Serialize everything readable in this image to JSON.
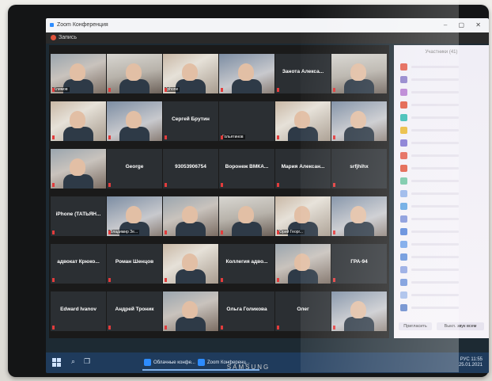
{
  "monitor": {
    "brand": "SAMSUNG",
    "corner_mark": ""
  },
  "window": {
    "title": "Zoom Конференция",
    "meeting_label": "Запись"
  },
  "gallery": {
    "tiles": [
      {
        "name": "",
        "label": "Климов",
        "video": true
      },
      {
        "name": "",
        "label": "",
        "video": true
      },
      {
        "name": "",
        "label": "Iphone",
        "video": true
      },
      {
        "name": "",
        "label": "",
        "video": true
      },
      {
        "name": "Занота Алекса...",
        "label": "",
        "video": false
      },
      {
        "name": "",
        "label": "",
        "video": true
      },
      {
        "name": "",
        "label": "",
        "video": true
      },
      {
        "name": "",
        "label": "",
        "video": true
      },
      {
        "name": "Сергей Брутин",
        "label": "",
        "video": false
      },
      {
        "name": "",
        "label": "Гольятинов",
        "video": false
      },
      {
        "name": "",
        "label": "",
        "video": true
      },
      {
        "name": "",
        "label": "",
        "video": true
      },
      {
        "name": "",
        "label": "",
        "video": true
      },
      {
        "name": "George",
        "label": "",
        "video": false
      },
      {
        "name": "93053906754",
        "label": "",
        "video": false
      },
      {
        "name": "Воронеж ВМКА...",
        "label": "",
        "video": false
      },
      {
        "name": "Мария Алексан...",
        "label": "",
        "video": false
      },
      {
        "name": "srfjhihx",
        "label": "",
        "video": false
      },
      {
        "name": "iPhone (ТАТЬЯН...",
        "label": "",
        "video": false
      },
      {
        "name": "",
        "label": "Владимир Зе...",
        "video": true
      },
      {
        "name": "",
        "label": "",
        "video": true
      },
      {
        "name": "",
        "label": "",
        "video": true
      },
      {
        "name": "",
        "label": "Юрий Георг...",
        "video": true
      },
      {
        "name": "",
        "label": "",
        "video": true
      },
      {
        "name": "адвокат Крюко...",
        "label": "",
        "video": false
      },
      {
        "name": "Роман Шенцов",
        "label": "",
        "video": false
      },
      {
        "name": "",
        "label": "",
        "video": true
      },
      {
        "name": "Коллегия адво...",
        "label": "",
        "video": false
      },
      {
        "name": "",
        "label": "",
        "video": true
      },
      {
        "name": "ГРА-94",
        "label": "",
        "video": false
      },
      {
        "name": "Edward Ivanov",
        "label": "",
        "video": false
      },
      {
        "name": "Андрей Троник",
        "label": "",
        "video": false
      },
      {
        "name": "",
        "label": "",
        "video": true
      },
      {
        "name": "Ольга Голикова",
        "label": "",
        "video": false
      },
      {
        "name": "Олег",
        "label": "",
        "video": false
      },
      {
        "name": "",
        "label": "",
        "video": true
      }
    ]
  },
  "panel": {
    "header": "Участники (41)",
    "invite_label": "Пригласить",
    "mute_all_label": "Выкл. звук всем",
    "avatar_colors": [
      "#e25b4b",
      "#8b7cc8",
      "#b57ad1",
      "#e0533b",
      "#2fb8b0",
      "#e8b730",
      "#7b6fd0",
      "#e25b4b",
      "#e0533b",
      "#6cc3a0",
      "#8fb0e8",
      "#5aa0e0",
      "#7b8fd8",
      "#4f7fd8",
      "#6b9ee8",
      "#5b8bd8",
      "#8aa0e0",
      "#6a8fd8",
      "#9fb8e8",
      "#5b7fc8"
    ]
  },
  "taskbar": {
    "apps": [
      "Облачные конфе...",
      "Zoom Конференц..."
    ],
    "clock_time": "11:55",
    "clock_date": "25.01.2021",
    "lang": "РУС"
  }
}
